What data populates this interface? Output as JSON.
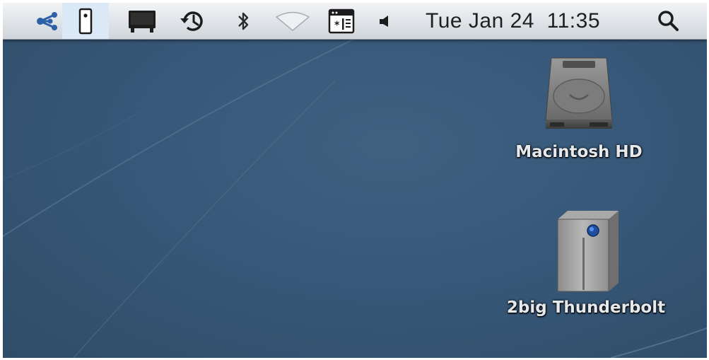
{
  "menubar": {
    "items": [
      {
        "id": "share",
        "icon": "share-network-icon"
      },
      {
        "id": "device",
        "icon": "device-status-icon",
        "highlighted": true
      },
      {
        "id": "display",
        "icon": "display-icon"
      },
      {
        "id": "time-machine",
        "icon": "time-machine-icon"
      },
      {
        "id": "bluetooth",
        "icon": "bluetooth-icon"
      },
      {
        "id": "wifi",
        "icon": "wifi-icon"
      },
      {
        "id": "battery",
        "icon": "window-status-icon"
      },
      {
        "id": "volume",
        "icon": "volume-icon"
      },
      {
        "id": "spotlight",
        "icon": "search-icon"
      }
    ],
    "clock": "Tue Jan 24  11:35"
  },
  "desktop": {
    "icons": [
      {
        "label": "Macintosh HD",
        "icon": "hard-drive-icon"
      },
      {
        "label": "2big Thunderbolt",
        "icon": "external-drive-icon"
      }
    ]
  },
  "colors": {
    "menubar_top": "#f2f4f6",
    "menubar_bottom": "#cfd5da",
    "desktop": "#38597a",
    "share_icon": "#2c5fa8",
    "highlight": "#dbe9f7"
  }
}
